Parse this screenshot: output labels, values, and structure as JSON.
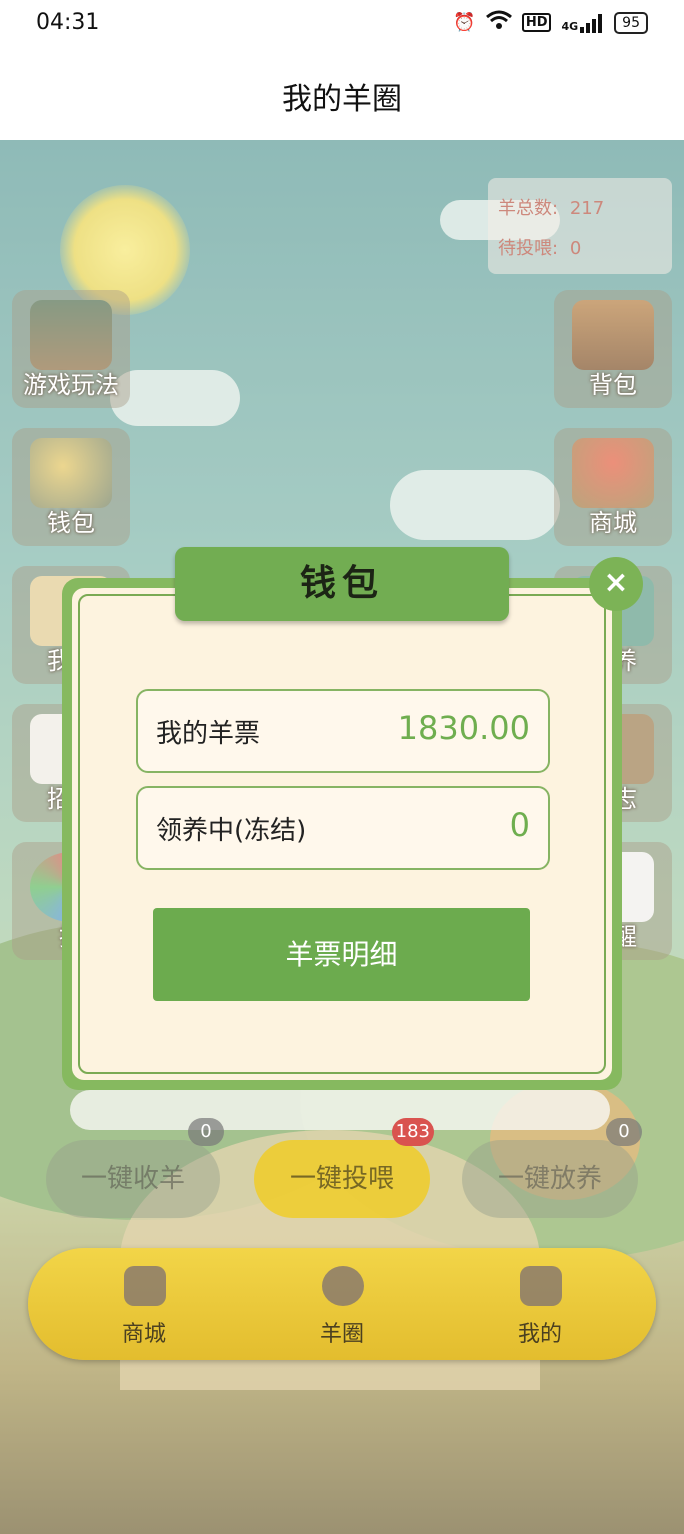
{
  "status": {
    "time": "04:31",
    "hd": "HD",
    "net": "4G",
    "battery": "95"
  },
  "page": {
    "title": "我的羊圈"
  },
  "stats": {
    "total_label": "羊总数:",
    "total_value": "217",
    "feed_label": "待投喂:",
    "feed_value": "0"
  },
  "side_left": [
    {
      "label": "游戏玩法"
    },
    {
      "label": "钱包"
    },
    {
      "label": "我的"
    },
    {
      "label": "招募"
    },
    {
      "label": "抽"
    }
  ],
  "side_right": [
    {
      "label": "背包"
    },
    {
      "label": "商城"
    },
    {
      "label": "领养"
    },
    {
      "label": "日志"
    },
    {
      "label": "提醒"
    }
  ],
  "actions": [
    {
      "label": "一键收羊",
      "badge": "0"
    },
    {
      "label": "一键投喂",
      "badge": "183"
    },
    {
      "label": "一键放养",
      "badge": "0"
    }
  ],
  "tabs": [
    {
      "label": "商城"
    },
    {
      "label": "羊圈"
    },
    {
      "label": "我的"
    }
  ],
  "wallet": {
    "title": "钱包",
    "close": "×",
    "ticket_label": "我的羊票",
    "ticket_value": "1830.00",
    "frozen_label": "领养中(冻结)",
    "frozen_value": "0",
    "detail_button": "羊票明细"
  },
  "colors": {
    "accent": "#72ad52",
    "value": "#6fae4f",
    "stat": "#b6503e"
  }
}
